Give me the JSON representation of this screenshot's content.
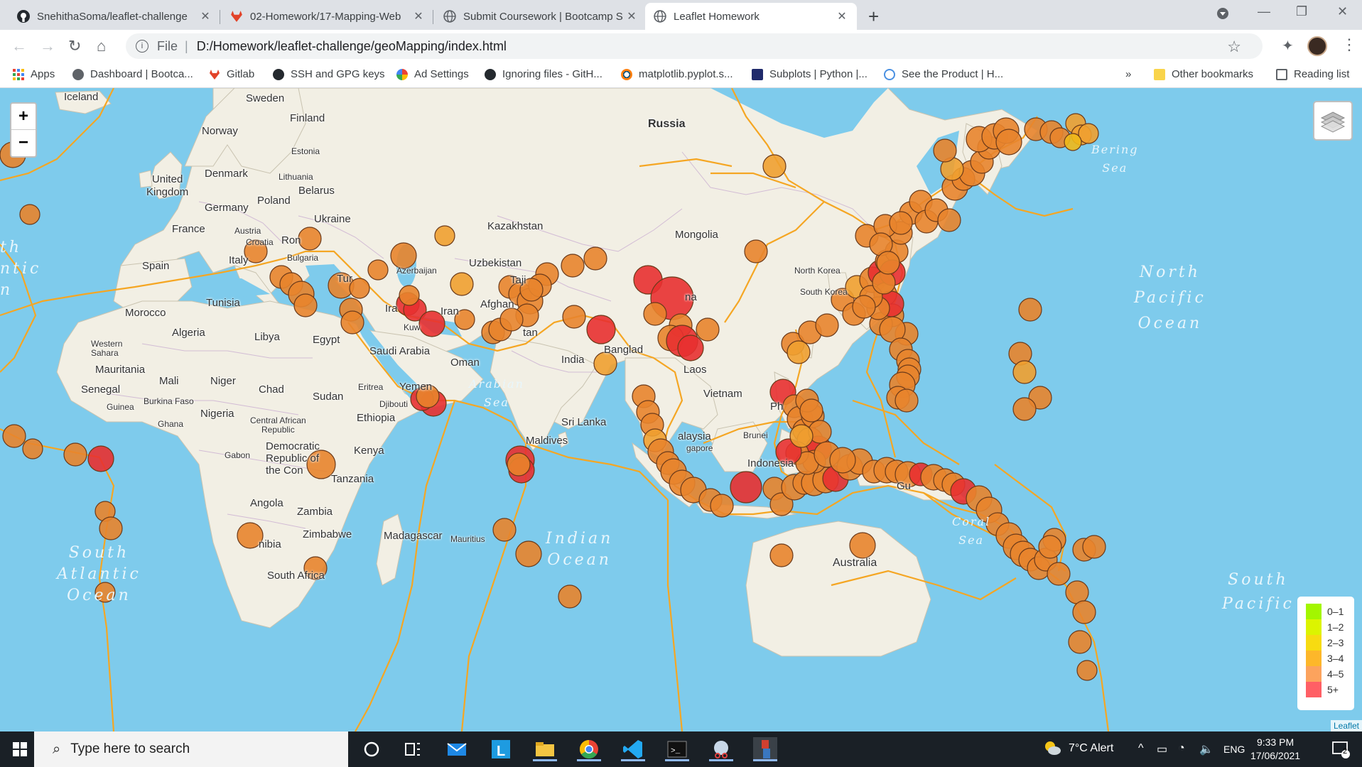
{
  "browser": {
    "tabs": [
      {
        "title": "SnehithaSoma/leaflet-challenge",
        "icon": "github-icon"
      },
      {
        "title": "02-Homework/17-Mapping-Web",
        "icon": "gitlab-icon"
      },
      {
        "title": "Submit Coursework | Bootcamp S",
        "icon": "globe-icon"
      },
      {
        "title": "Leaflet Homework",
        "icon": "globe-icon",
        "active": true
      }
    ],
    "new_tab": "+",
    "address": {
      "scheme": "File",
      "path": "D:/Homework/leaflet-challenge/geoMapping/index.html"
    },
    "bookmarks": [
      {
        "label": "Apps",
        "icon": "apps-grid-icon"
      },
      {
        "label": "Dashboard | Bootca...",
        "icon": "globe-icon"
      },
      {
        "label": "Gitlab",
        "icon": "gitlab-icon"
      },
      {
        "label": "SSH and GPG keys",
        "icon": "github-icon"
      },
      {
        "label": "Ad Settings",
        "icon": "google-icon"
      },
      {
        "label": "Ignoring files - GitH...",
        "icon": "github-icon"
      },
      {
        "label": "matplotlib.pyplot.s...",
        "icon": "matplotlib-icon"
      },
      {
        "label": "Subplots | Python |...",
        "icon": "plotly-icon"
      },
      {
        "label": "See the Product | H...",
        "icon": "globe-icon"
      }
    ],
    "bookmarks_more": "»",
    "other_bookmarks": "Other bookmarks",
    "reading_list": "Reading list"
  },
  "map": {
    "zoom_in": "+",
    "zoom_out": "−",
    "attribution": "Leaflet",
    "labels": {
      "iceland": "Iceland",
      "sweden": "Sweden",
      "finland": "Finland",
      "norway": "Norway",
      "russia": "Russia",
      "estonia": "Estonia",
      "denmark": "Denmark",
      "lithuania": "Lithuania",
      "united_kingdom": "United\nKingdom",
      "belarus": "Belarus",
      "poland": "Poland",
      "germany": "Germany",
      "ukraine": "Ukraine",
      "france": "France",
      "austria": "Austria",
      "croatia": "Croatia",
      "romania": "Ron",
      "bulgaria": "Bulgaria",
      "italy": "Italy",
      "spain": "Spain",
      "turkey": "Tur",
      "azerbaijan": "Azerbaijan",
      "kazakhstan": "Kazakhstan",
      "uzbekistan": "Uzbekistan",
      "mongolia": "Mongolia",
      "north_korea": "North Korea",
      "south_korea": "South Korea",
      "china": "na",
      "tajikistan": "Taji",
      "afghanistan": "Afghan",
      "pakistan": "tan",
      "iraq": "Ira",
      "iran": "Iran",
      "kuwait": "Kuw",
      "morocco": "Morocco",
      "tunisia": "Tunisia",
      "algeria": "Algeria",
      "libya": "Libya",
      "egypt": "Egypt",
      "saudi_arabia": "Saudi Arabia",
      "oman": "Oman",
      "india": "India",
      "bangladesh": "Banglad",
      "laos": "Laos",
      "western_sahara": "Western\nSahara",
      "mauritania": "Mauritania",
      "mali": "Mali",
      "niger": "Niger",
      "chad": "Chad",
      "sudan": "Sudan",
      "eritrea": "Eritrea",
      "yemen": "Yemen",
      "djibouti": "Djibouti",
      "senegal": "Senegal",
      "guinea": "Guinea",
      "burkina_faso": "Burkina Faso",
      "nigeria": "Nigeria",
      "ghana": "Ghana",
      "ethiopia": "Ethiopia",
      "car": "Central African\nRepublic",
      "drc": "Democratic\nRepublic of\nthe Con",
      "gabon": "Gabon",
      "kenya": "Kenya",
      "tanzania": "Tanzania",
      "angola": "Angola",
      "zambia": "Zambia",
      "zimbabwe": "Zimbabwe",
      "namibia": "nibia",
      "south_africa": "South Africa",
      "madagascar": "Madagascar",
      "mauritius": "Mauritius",
      "sri_lanka": "Sri Lanka",
      "maldives": "Maldives",
      "vietnam": "Vietnam",
      "malaysia": "alaysia",
      "singapore": "gapore",
      "brunei": "Brunei",
      "philippines": "Ph",
      "indonesia": "Indonesia",
      "png": "Gu",
      "australia": "Australia"
    },
    "oceans": {
      "north_pacific": "North\nPacific\nOcean",
      "indian": "Indian\nOcean",
      "south_atlantic": "South\nAtlantic\nOcean",
      "north_atlantic": "th\nntic\nn",
      "south_pacific": "South\nPacific",
      "bering": "Bering\nSea",
      "arabian": "Arabian\nSea",
      "coral": "Coral\nSea"
    },
    "legend": [
      {
        "label": "0–1",
        "color": "#a3f600"
      },
      {
        "label": "1–2",
        "color": "#dcf400"
      },
      {
        "label": "2–3",
        "color": "#f7db11"
      },
      {
        "label": "3–4",
        "color": "#fdb72a"
      },
      {
        "label": "4–5",
        "color": "#fca35d"
      },
      {
        "label": "5+",
        "color": "#ff5f65"
      }
    ],
    "marker_colors": {
      "depth_shallow": "#f0a030",
      "depth_mid": "#e8842c",
      "depth_deep": "#e83030",
      "plates": "#f5a623"
    }
  },
  "taskbar": {
    "search_placeholder": "Type here to search",
    "weather": "7°C  Alert",
    "language": "ENG",
    "time": "9:33 PM",
    "date": "17/06/2021",
    "notifications": "2"
  }
}
